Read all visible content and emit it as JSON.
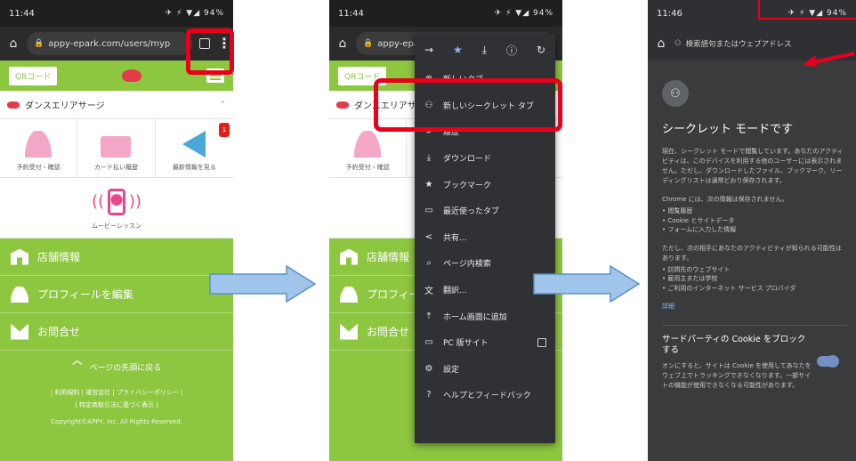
{
  "phone1": {
    "status": {
      "time": "11:44",
      "icons": "✈ ⚡ ▼◢ 94%"
    },
    "url": "appy-epark.com/users/myp",
    "qr_label": "QRコード",
    "store_name": "ダンスエリアサージ",
    "icons": [
      {
        "label": "予約受付・確認"
      },
      {
        "label": "カード払い履歴"
      },
      {
        "label": "最新情報を見る",
        "badge": "1"
      }
    ],
    "movie_label": "ムービーレッスン",
    "nav": [
      {
        "label": "店舗情報"
      },
      {
        "label": "プロフィールを編集"
      },
      {
        "label": "お問合せ"
      }
    ],
    "back_to_top": "ページの先頭に戻る",
    "footer_links": "| 利用規約 | 運営会社 | プライバシーポリシー |",
    "footer_links2": "| 特定商取引法に基づく表示 |",
    "copyright": "Copyright©APPY, Inc. All Rights Reserved."
  },
  "phone2": {
    "status": {
      "time": "11:44",
      "icons": "✈ ⚡ ▼◢ 94%"
    },
    "url": "appy-epa",
    "nav": [
      {
        "label": "店舗情報"
      },
      {
        "label": "プロフィール"
      },
      {
        "label": "お問合せ"
      }
    ],
    "menu": [
      {
        "icon": "⊕",
        "label": "新しいタブ"
      },
      {
        "icon": "⚇",
        "label": "新しいシークレット タブ"
      },
      {
        "icon": "↺",
        "label": "履歴"
      },
      {
        "icon": "⤓",
        "label": "ダウンロード"
      },
      {
        "icon": "★",
        "label": "ブックマーク"
      },
      {
        "icon": "▭",
        "label": "最近使ったタブ"
      },
      {
        "icon": "<",
        "label": "共有..."
      },
      {
        "icon": "⌕",
        "label": "ページ内検索"
      },
      {
        "icon": "文",
        "label": "翻訳..."
      },
      {
        "icon": "⤒",
        "label": "ホーム画面に追加"
      },
      {
        "icon": "▭",
        "label": "PC 版サイト"
      },
      {
        "icon": "⚙",
        "label": "設定"
      },
      {
        "icon": "?",
        "label": "ヘルプとフィードバック"
      }
    ]
  },
  "phone3": {
    "status": {
      "time": "11:46",
      "icons": "✈ ⚡ ▼◢ 94%"
    },
    "url_placeholder": "検索語句またはウェブアドレス",
    "title": "シークレット モードです",
    "para1": "現在、シークレット モードで閲覧しています。あなたのアクティビティは、このデバイスを利用する他のユーザーには表示されません。ただし、ダウンロードしたファイル、ブックマーク、リーディングリストは通常どおり保存されます。",
    "para2": "Chrome には、次の情報は保存されません。",
    "list1": [
      "閲覧履歴",
      "Cookie とサイトデータ",
      "フォームに入力した情報"
    ],
    "para3": "ただし、次の相手にあなたのアクティビティが知られる可能性はあります。",
    "list2": [
      "訪問先のウェブサイト",
      "雇用主または学校",
      "ご利用のインターネット サービス プロバイダ"
    ],
    "learn_more": "詳細",
    "cookie_title": "サードパーティの Cookie をブロックする",
    "cookie_desc": "オンにすると、サイトは Cookie を使用してあなたをウェブ上でトラッキングできなくなります。一部サイトの機能が使用できなくなる可能性があります。"
  },
  "colors": {
    "site_green": "#8dc63f",
    "highlight_red": "#e8001c",
    "arrow_blue": "#9fc5ea",
    "incognito_bg": "#3a3b3d"
  }
}
